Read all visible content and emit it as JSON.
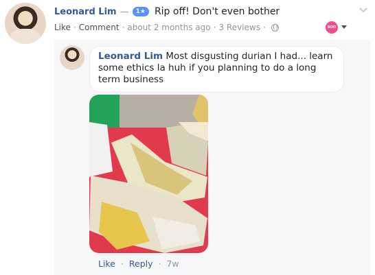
{
  "review": {
    "author": "Leonard Lim",
    "dash": "—",
    "rating": "1★",
    "text": "Rip off! Don't even bother",
    "like_label": "Like",
    "comment_label": "Comment",
    "time": "about 2 months ago",
    "reviews_count": "3 Reviews",
    "separator": "·",
    "reaction_icon_text": "BOO"
  },
  "comment": {
    "author": "Leonard Lim",
    "text": " Most disgusting durian I had... learn some ethics la huh if you planning to do a long term business",
    "like_label": "Like",
    "reply_label": "Reply",
    "time": "7w",
    "separator": "·"
  },
  "icons": {
    "privacy": "globe-icon",
    "more": "chevron-down-icon",
    "reaction": "reaction-icon",
    "reaction_menu": "caret-down-icon"
  },
  "colors": {
    "link": "#365899",
    "muted": "#90949c",
    "rating_badge": "#5890ff",
    "comment_bg": "#f6f7f9"
  }
}
